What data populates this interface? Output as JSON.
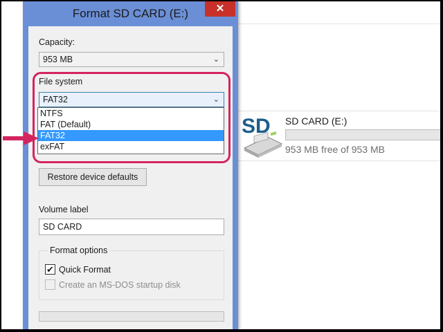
{
  "dialog": {
    "title": "Format SD CARD (E:)",
    "close_icon": "✕",
    "capacity_label": "Capacity:",
    "capacity_value": "953 MB",
    "filesystem_label": "File system",
    "filesystem_value": "FAT32",
    "filesystem_options": [
      "NTFS",
      "FAT (Default)",
      "FAT32",
      "exFAT"
    ],
    "filesystem_selected_index": 2,
    "restore_button": "Restore device defaults",
    "volume_label": "Volume label",
    "volume_value": "SD CARD",
    "format_options_title": "Format options",
    "quick_format_label": "Quick Format",
    "quick_format_checked": true,
    "msdos_label": "Create an MS-DOS startup disk",
    "msdos_enabled": false,
    "progress": 0
  },
  "explorer": {
    "drive_name": "SD CARD (E:)",
    "drive_free": "953 MB free of 953 MB",
    "drive_used_fraction": 0,
    "drive_icon_text": "SD"
  },
  "colors": {
    "dialog_frame": "#6b8fd6",
    "close_button": "#c7312a",
    "selection": "#3399ff",
    "annotation": "#d4245f",
    "sd_logo": "#1c5e8c"
  }
}
